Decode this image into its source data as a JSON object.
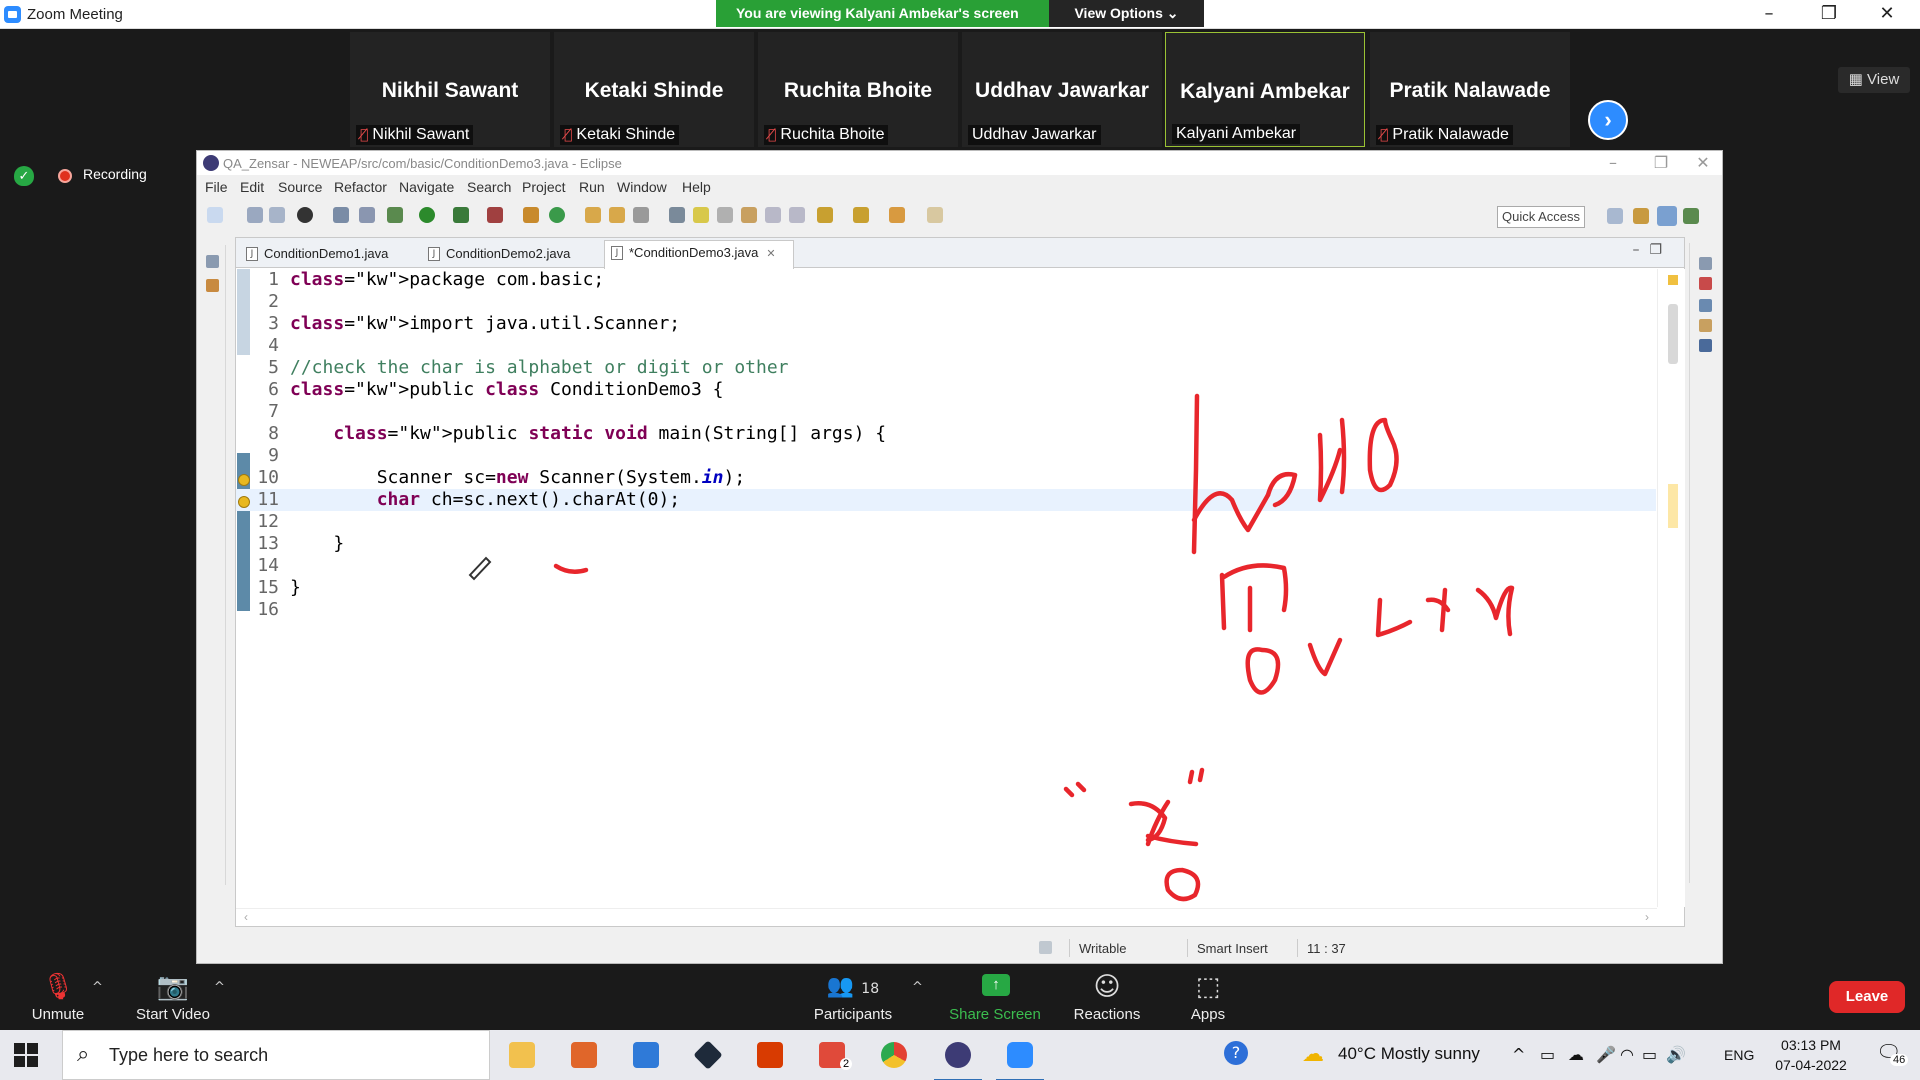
{
  "zoom": {
    "window_title": "Zoom Meeting",
    "banner_text": "You are viewing Kalyani Ambekar's screen",
    "view_options": "View Options ⌄",
    "view_button": "View",
    "recording": "Recording",
    "participants": [
      {
        "big": "Nikhil Sawant",
        "small": "Nikhil Sawant",
        "muted": true
      },
      {
        "big": "Ketaki Shinde",
        "small": "Ketaki Shinde",
        "muted": true
      },
      {
        "big": "Ruchita Bhoite",
        "small": "Ruchita Bhoite",
        "muted": true
      },
      {
        "big": "Uddhav Jawarkar",
        "small": "Uddhav Jawarkar",
        "muted": false
      },
      {
        "big": "Kalyani Ambekar",
        "small": "Kalyani Ambekar",
        "muted": false,
        "active": true
      },
      {
        "big": "Pratik Nalawade",
        "small": "Pratik Nalawade",
        "muted": true
      }
    ],
    "bottom": {
      "unmute": "Unmute",
      "start_video": "Start Video",
      "participants": "Participants",
      "participant_count": "18",
      "share_screen": "Share Screen",
      "reactions": "Reactions",
      "apps": "Apps",
      "leave": "Leave"
    }
  },
  "eclipse": {
    "title": "QA_Zensar - NEWEAP/src/com/basic/ConditionDemo3.java - Eclipse",
    "menu": [
      "File",
      "Edit",
      "Source",
      "Refactor",
      "Navigate",
      "Search",
      "Project",
      "Run",
      "Window",
      "Help"
    ],
    "quick_access": "Quick Access",
    "tabs": [
      "ConditionDemo1.java",
      "ConditionDemo2.java",
      "*ConditionDemo3.java"
    ],
    "lines": [
      {
        "n": "1",
        "text": "package com.basic;"
      },
      {
        "n": "2",
        "text": ""
      },
      {
        "n": "3",
        "text": "import java.util.Scanner;"
      },
      {
        "n": "4",
        "text": ""
      },
      {
        "n": "5",
        "text": "//check the char is alphabet or digit or other"
      },
      {
        "n": "6",
        "text": "public class ConditionDemo3 {"
      },
      {
        "n": "7",
        "text": ""
      },
      {
        "n": "8",
        "text": "    public static void main(String[] args) {"
      },
      {
        "n": "9",
        "text": ""
      },
      {
        "n": "10",
        "text": "        Scanner sc=new Scanner(System.in);"
      },
      {
        "n": "11",
        "text": "        char ch=sc.next().charAt(0);"
      },
      {
        "n": "12",
        "text": ""
      },
      {
        "n": "13",
        "text": "    }"
      },
      {
        "n": "14",
        "text": ""
      },
      {
        "n": "15",
        "text": "}"
      },
      {
        "n": "16",
        "text": ""
      }
    ],
    "status": {
      "writable": "Writable",
      "insert_mode": "Smart Insert",
      "position": "11 : 37"
    }
  },
  "taskbar": {
    "search_placeholder": "Type here to search",
    "weather": "40°C  Mostly sunny",
    "language": "ENG",
    "time": "03:13 PM",
    "date": "07-04-2022",
    "notification_count": "46",
    "gmail_badge": "2"
  },
  "colors": {
    "zoom_green": "#29a036",
    "zoom_blue": "#2d8cff",
    "ink_red": "#e8262c",
    "leave_red": "#e02828"
  }
}
